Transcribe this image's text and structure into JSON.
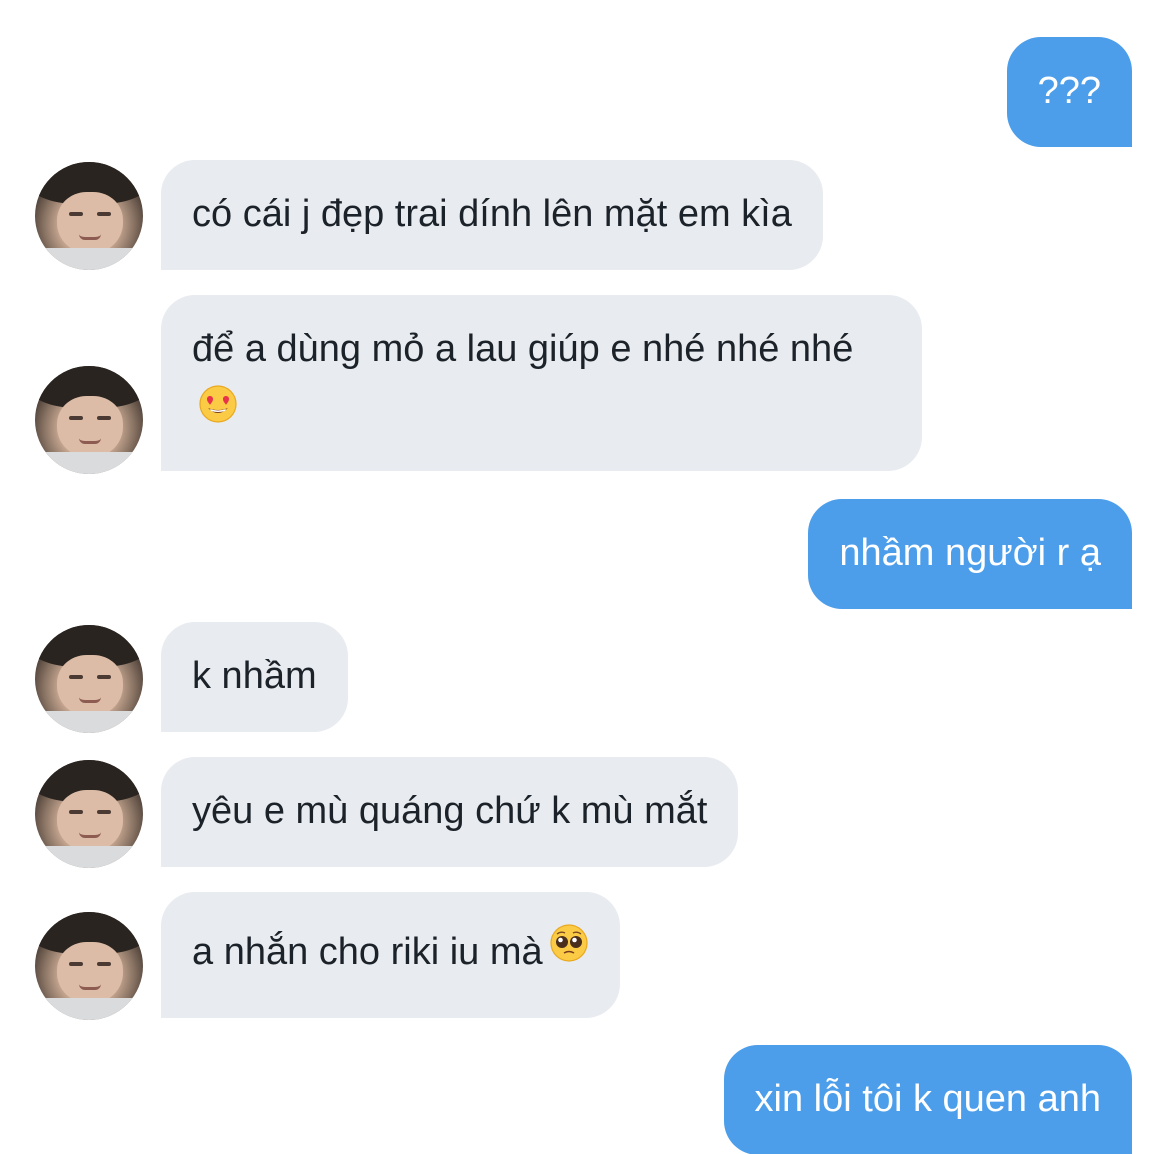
{
  "messages": [
    {
      "text": "???"
    },
    {
      "text": "có cái j đẹp trai dính lên mặt em kìa"
    },
    {
      "text": "để a dùng mỏ a lau giúp e nhé nhé nhé"
    },
    {
      "text": "nhầm người r ạ"
    },
    {
      "text": "k nhầm"
    },
    {
      "text": "yêu e mù quáng chứ k mù mắt"
    },
    {
      "text": "a nhắn cho riki iu mà"
    },
    {
      "text": "xin lỗi tôi k quen anh"
    }
  ],
  "icons": {
    "heart_eyes": "smiling-face-with-heart-eyes-emoji",
    "pleading": "pleading-face-emoji",
    "avatar": "user-avatar-photo"
  },
  "colors": {
    "incoming_bubble": "#e8ebef",
    "incoming_text": "#1c2229",
    "outgoing_bubble": "#4c9eea",
    "outgoing_text": "#ffffff"
  }
}
